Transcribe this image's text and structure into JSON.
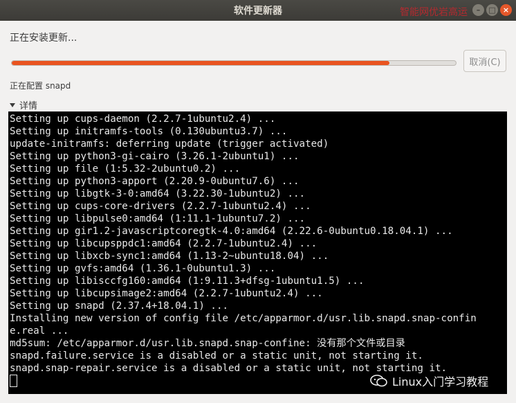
{
  "window": {
    "title": "软件更新器",
    "watermark": "智能网优岩高运"
  },
  "controls": {
    "minimize": "–",
    "maximize": "□",
    "close": "×"
  },
  "status": {
    "heading": "正在安装更新...",
    "progress": 0.85,
    "cancel_label": "取消(C)",
    "current_action": "正在配置 snapd"
  },
  "details": {
    "label": "详情"
  },
  "terminal": {
    "lines": [
      "Setting up cups-daemon (2.2.7-1ubuntu2.4) ...",
      "Setting up initramfs-tools (0.130ubuntu3.7) ...",
      "update-initramfs: deferring update (trigger activated)",
      "Setting up python3-gi-cairo (3.26.1-2ubuntu1) ...",
      "Setting up file (1:5.32-2ubuntu0.2) ...",
      "Setting up python3-apport (2.20.9-0ubuntu7.6) ...",
      "Setting up libgtk-3-0:amd64 (3.22.30-1ubuntu2) ...",
      "Setting up cups-core-drivers (2.2.7-1ubuntu2.4) ...",
      "Setting up libpulse0:amd64 (1:11.1-1ubuntu7.2) ...",
      "Setting up gir1.2-javascriptcoregtk-4.0:amd64 (2.22.6-0ubuntu0.18.04.1) ...",
      "Setting up libcupsppdc1:amd64 (2.2.7-1ubuntu2.4) ...",
      "Setting up libxcb-sync1:amd64 (1.13-2~ubuntu18.04) ...",
      "Setting up gvfs:amd64 (1.36.1-0ubuntu1.3) ...",
      "Setting up libisccfg160:amd64 (1:9.11.3+dfsg-1ubuntu1.5) ...",
      "Setting up libcupsimage2:amd64 (2.2.7-1ubuntu2.4) ...",
      "Setting up snapd (2.37.4+18.04.1) ...",
      "Installing new version of config file /etc/apparmor.d/usr.lib.snapd.snap-confin",
      "e.real ...",
      "md5sum: /etc/apparmor.d/usr.lib.snapd.snap-confine: 没有那个文件或目录",
      "snapd.failure.service is a disabled or a static unit, not starting it.",
      "snapd.snap-repair.service is a disabled or a static unit, not starting it."
    ]
  },
  "badge": {
    "text": "Linux入门学习教程"
  },
  "colors": {
    "accent": "#e95420",
    "terminal_bg": "#000000",
    "titlebar": "#3c3b37"
  }
}
